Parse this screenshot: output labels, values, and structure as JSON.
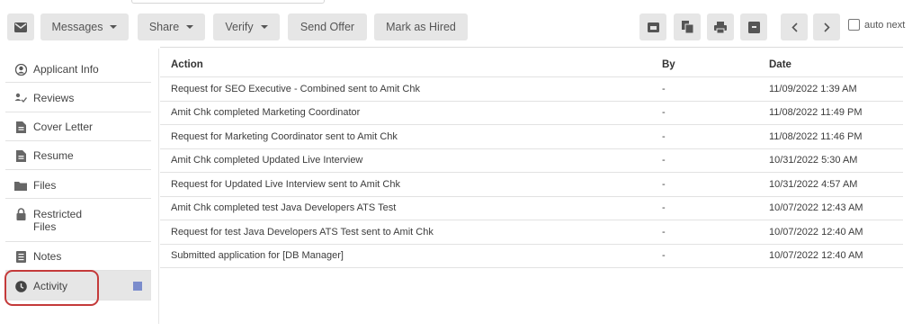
{
  "toolbar": {
    "messages_label": "Messages",
    "share_label": "Share",
    "verify_label": "Verify",
    "send_offer_label": "Send Offer",
    "mark_hired_label": "Mark as Hired",
    "auto_next_label": "auto next",
    "icons": [
      "email-icon",
      "id-card-icon",
      "copy-icon",
      "print-icon",
      "archive-icon",
      "chevron-left-icon",
      "chevron-right-icon"
    ]
  },
  "sidebar": {
    "items": [
      {
        "label": "Applicant Info",
        "icon": "user-icon"
      },
      {
        "label": "Reviews",
        "icon": "reviews-icon"
      },
      {
        "label": "Cover Letter",
        "icon": "document-icon"
      },
      {
        "label": "Resume",
        "icon": "document-icon"
      },
      {
        "label": "Files",
        "icon": "folder-icon"
      },
      {
        "label": "Restricted Files",
        "icon": "lock-icon"
      },
      {
        "label": "Notes",
        "icon": "notes-icon"
      },
      {
        "label": "Activity",
        "icon": "clock-icon",
        "active": true
      }
    ],
    "active_marker_color": "#7b8ccc",
    "highlight_color": "#c43a3a"
  },
  "activity_table": {
    "headers": {
      "action": "Action",
      "by": "By",
      "date": "Date"
    },
    "rows": [
      {
        "action": "Request for SEO Executive - Combined sent to Amit Chk",
        "by": "-",
        "date": "11/09/2022 1:39 AM"
      },
      {
        "action": "Amit Chk completed Marketing Coordinator",
        "by": "-",
        "date": "11/08/2022 11:49 PM"
      },
      {
        "action": "Request for Marketing Coordinator sent to Amit Chk",
        "by": "-",
        "date": "11/08/2022 11:46 PM"
      },
      {
        "action": "Amit Chk completed Updated Live Interview",
        "by": "-",
        "date": "10/31/2022 5:30 AM"
      },
      {
        "action": "Request for Updated Live Interview sent to Amit Chk",
        "by": "-",
        "date": "10/31/2022 4:57 AM"
      },
      {
        "action": "Amit Chk completed test Java Developers ATS Test",
        "by": "-",
        "date": "10/07/2022 12:43 AM"
      },
      {
        "action": "Request for test Java Developers ATS Test sent to Amit Chk",
        "by": "-",
        "date": "10/07/2022 12:40 AM"
      },
      {
        "action": "Submitted application for [DB Manager]",
        "by": "-",
        "date": "10/07/2022 12:40 AM"
      }
    ]
  }
}
